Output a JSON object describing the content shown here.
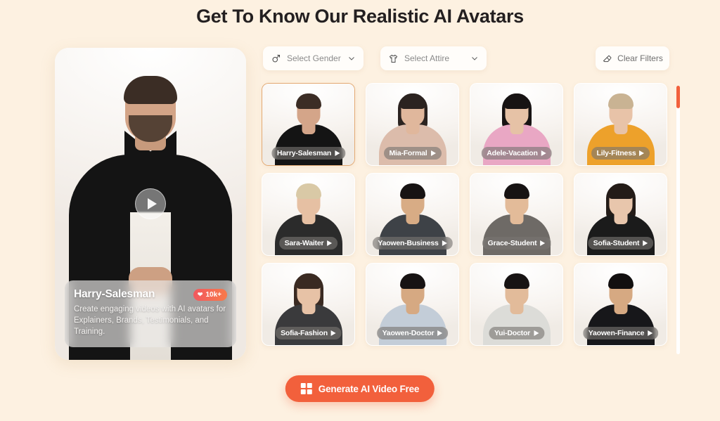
{
  "page": {
    "title": "Get To Know Our Realistic AI Avatars",
    "background_color": "#fdf1e1",
    "accent_color": "#f2603c"
  },
  "preview": {
    "name": "Harry-Salesman",
    "likes": "10k+",
    "likes_icon": "heart-icon",
    "description": "Create engaging videos with AI avatars for Explainers, Brands, Testimonials, and Training.",
    "play_icon": "play-icon"
  },
  "filters": {
    "gender": {
      "label": "Select Gender",
      "icon": "male-symbol-icon",
      "chevron": "chevron-down-icon"
    },
    "attire": {
      "label": "Select Attire",
      "icon": "tshirt-icon",
      "chevron": "chevron-down-icon"
    },
    "clear": {
      "label": "Clear Filters",
      "icon": "eraser-icon"
    }
  },
  "grid": {
    "selected_index": 0,
    "avatars": [
      {
        "name": "Harry-Salesman",
        "play_icon": "play-icon",
        "hair": "#3b2d25",
        "skin": "#d4a589",
        "outfit": "#141414",
        "long_hair": false
      },
      {
        "name": "Mia-Formal",
        "play_icon": "play-icon",
        "hair": "#2b2320",
        "skin": "#e0b79c",
        "outfit": "#dcbcab",
        "long_hair": true
      },
      {
        "name": "Adele-Vacation",
        "play_icon": "play-icon",
        "hair": "#171313",
        "skin": "#e6c2a6",
        "outfit": "#e9a7c4",
        "long_hair": true
      },
      {
        "name": "Lily-Fitness",
        "play_icon": "play-icon",
        "hair": "#c9b393",
        "skin": "#e8c3a8",
        "outfit": "#eda12b",
        "long_hair": false
      },
      {
        "name": "Sara-Waiter",
        "play_icon": "play-icon",
        "hair": "#d9c9a6",
        "skin": "#e6c0a3",
        "outfit": "#2b2b2b",
        "long_hair": false
      },
      {
        "name": "Yaowen-Business",
        "play_icon": "play-icon",
        "hair": "#171313",
        "skin": "#d8ac85",
        "outfit": "#3e4247",
        "long_hair": false
      },
      {
        "name": "Grace-Student",
        "play_icon": "play-icon",
        "hair": "#171313",
        "skin": "#e3bb99",
        "outfit": "#6e6a66",
        "long_hair": false
      },
      {
        "name": "Sofia-Student",
        "play_icon": "play-icon",
        "hair": "#241c18",
        "skin": "#e8c6ac",
        "outfit": "#1b1b1b",
        "long_hair": true
      },
      {
        "name": "Sofia-Fashion",
        "play_icon": "play-icon",
        "hair": "#3a2a22",
        "skin": "#e7c2a6",
        "outfit": "#3a3a3c",
        "long_hair": true
      },
      {
        "name": "Yaowen-Doctor",
        "play_icon": "play-icon",
        "hair": "#171313",
        "skin": "#d6a982",
        "outfit": "#c3cdd8",
        "long_hair": false
      },
      {
        "name": "Yui-Doctor",
        "play_icon": "play-icon",
        "hair": "#171313",
        "skin": "#e2bb9a",
        "outfit": "#dcdcd8",
        "long_hair": false
      },
      {
        "name": "Yaowen-Finance",
        "play_icon": "play-icon",
        "hair": "#120f0f",
        "skin": "#d6a982",
        "outfit": "#17171a",
        "long_hair": false
      }
    ]
  },
  "scrollbar": {
    "thumb_color": "#f2603c"
  },
  "cta": {
    "label": "Generate AI Video Free",
    "icon": "windows-grid-icon"
  }
}
